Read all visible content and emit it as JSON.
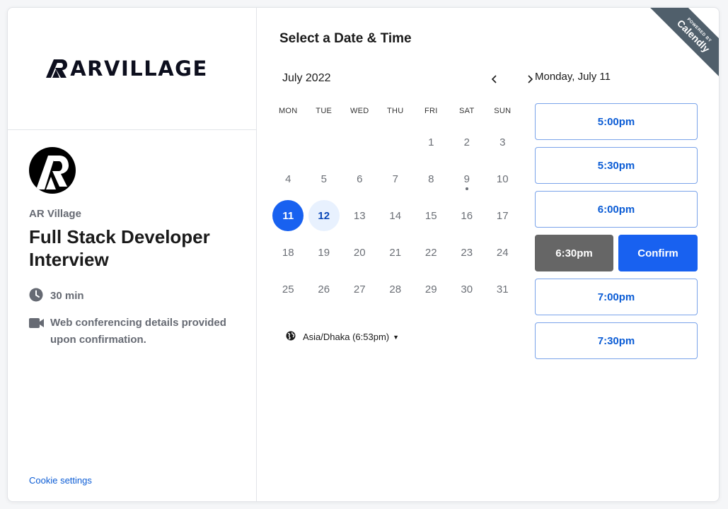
{
  "brand": {
    "logo_text": "ARVILLAGE"
  },
  "event": {
    "organizer": "AR Village",
    "title": "Full Stack Developer Interview",
    "duration": "30 min",
    "location_note": "Web conferencing details provided upon confirmation."
  },
  "footer": {
    "cookie_label": "Cookie settings"
  },
  "ribbon": {
    "line1": "POWERED BY",
    "line2": "Calendly"
  },
  "scheduler": {
    "heading": "Select a Date & Time",
    "month_label": "July 2022",
    "weekdays": [
      "MON",
      "TUE",
      "WED",
      "THU",
      "FRI",
      "SAT",
      "SUN"
    ],
    "weeks": [
      [
        null,
        null,
        null,
        null,
        {
          "d": "1"
        },
        {
          "d": "2"
        },
        {
          "d": "3"
        }
      ],
      [
        {
          "d": "4"
        },
        {
          "d": "5"
        },
        {
          "d": "6"
        },
        {
          "d": "7"
        },
        {
          "d": "8"
        },
        {
          "d": "9",
          "dot": true
        },
        {
          "d": "10"
        }
      ],
      [
        {
          "d": "11",
          "state": "selected"
        },
        {
          "d": "12",
          "state": "available"
        },
        {
          "d": "13"
        },
        {
          "d": "14"
        },
        {
          "d": "15"
        },
        {
          "d": "16"
        },
        {
          "d": "17"
        }
      ],
      [
        {
          "d": "18"
        },
        {
          "d": "19"
        },
        {
          "d": "20"
        },
        {
          "d": "21"
        },
        {
          "d": "22"
        },
        {
          "d": "23"
        },
        {
          "d": "24"
        }
      ],
      [
        {
          "d": "25"
        },
        {
          "d": "26"
        },
        {
          "d": "27"
        },
        {
          "d": "28"
        },
        {
          "d": "29"
        },
        {
          "d": "30"
        },
        {
          "d": "31"
        }
      ]
    ],
    "timezone": "Asia/Dhaka (6:53pm)",
    "selected_date_label": "Monday, July 11",
    "slots": [
      "5:00pm",
      "5:30pm",
      "6:00pm",
      "6:30pm",
      "7:00pm",
      "7:30pm"
    ],
    "selected_slot": "6:30pm",
    "confirm_label": "Confirm"
  },
  "colors": {
    "primary": "#1861f0",
    "selected_slot_bg": "#666666",
    "available_day_bg": "#e8f1fe",
    "ribbon_bg": "#505f6b"
  }
}
